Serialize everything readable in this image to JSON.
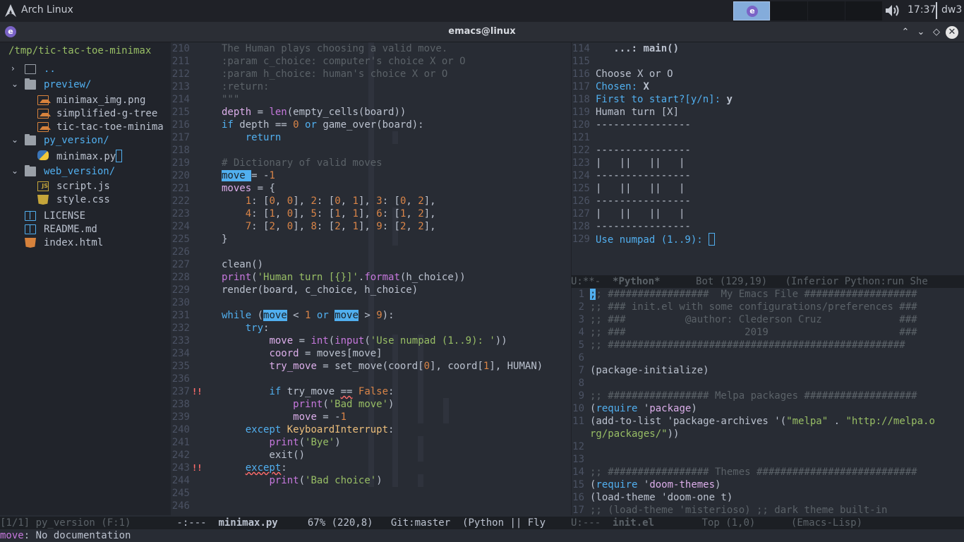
{
  "topbar": {
    "os_title": "Arch Linux",
    "workspace_app": "e",
    "clock": "17:37",
    "wm": "dw3",
    "icons": [
      "arch-linux-icon",
      "emacs-icon",
      "volume-icon"
    ]
  },
  "window": {
    "title": "emacs@linux",
    "app_icon": "e",
    "buttons": [
      "⌃",
      "⌄",
      "◇",
      "✕"
    ]
  },
  "treemacs": {
    "root": "/tmp/tic-tac-toe-minimax",
    "items": [
      {
        "chevron": "›",
        "icon": "book",
        "label": ".."
      },
      {
        "chevron": "⌄",
        "icon": "folder",
        "label": "preview/"
      },
      {
        "chevron": "",
        "icon": "image",
        "label": "minimax_img.png"
      },
      {
        "chevron": "",
        "icon": "image",
        "label": "simplified-g-tree"
      },
      {
        "chevron": "",
        "icon": "image",
        "label": "tic-tac-toe-minima"
      },
      {
        "chevron": "⌄",
        "icon": "folder",
        "label": "py_version/"
      },
      {
        "chevron": "",
        "icon": "python",
        "label": "minimax.py"
      },
      {
        "chevron": "⌄",
        "icon": "folder",
        "label": "web_version/"
      },
      {
        "chevron": "",
        "icon": "js",
        "label": "script.js"
      },
      {
        "chevron": "",
        "icon": "css",
        "label": "style.css"
      },
      {
        "chevron": "",
        "icon": "doc",
        "label": "LICENSE"
      },
      {
        "chevron": "",
        "icon": "doc",
        "label": "README.md"
      },
      {
        "chevron": "",
        "icon": "html",
        "label": "index.html"
      }
    ]
  },
  "editor_python": {
    "lines": [
      {
        "n": "210",
        "html": "<span class='c'>The Human plays choosing a valid move.</span>"
      },
      {
        "n": "211",
        "html": "<span class='c'>:param c_choice: computer's choice X or O</span>"
      },
      {
        "n": "212",
        "html": "<span class='c'>:param h_choice: human's choice X or O</span>"
      },
      {
        "n": "213",
        "html": "<span class='c'>:return:</span>"
      },
      {
        "n": "214",
        "html": "<span class='c'>\"\"\"</span>"
      },
      {
        "n": "215",
        "html": "<span class='v'>depth</span> = <span class='f'>len</span>(empty_cells(board))"
      },
      {
        "n": "216",
        "html": "<span class='k'>if</span> depth == <span class='n'>0</span> <span class='k'>or</span> game_over(board):"
      },
      {
        "n": "217",
        "html": "    <span class='k'>return</span>"
      },
      {
        "n": "218",
        "html": ""
      },
      {
        "n": "219",
        "html": "<span class='c'># Dictionary of valid moves</span>"
      },
      {
        "n": "220",
        "html": "<span class='hl'>move </span>= -<span class='n'>1</span>"
      },
      {
        "n": "221",
        "html": "<span class='v'>moves</span> = {"
      },
      {
        "n": "222",
        "html": "    <span class='n'>1</span>: [<span class='n'>0</span>, <span class='n'>0</span>], <span class='n'>2</span>: [<span class='n'>0</span>, <span class='n'>1</span>], <span class='n'>3</span>: [<span class='n'>0</span>, <span class='n'>2</span>],"
      },
      {
        "n": "223",
        "html": "    <span class='n'>4</span>: [<span class='n'>1</span>, <span class='n'>0</span>], <span class='n'>5</span>: [<span class='n'>1</span>, <span class='n'>1</span>], <span class='n'>6</span>: [<span class='n'>1</span>, <span class='n'>2</span>],"
      },
      {
        "n": "224",
        "html": "    <span class='n'>7</span>: [<span class='n'>2</span>, <span class='n'>0</span>], <span class='n'>8</span>: [<span class='n'>2</span>, <span class='n'>1</span>], <span class='n'>9</span>: [<span class='n'>2</span>, <span class='n'>2</span>],"
      },
      {
        "n": "225",
        "html": "}"
      },
      {
        "n": "226",
        "html": ""
      },
      {
        "n": "227",
        "html": "clean()"
      },
      {
        "n": "228",
        "html": "<span class='f'>print</span>(<span class='s'>'Human turn [{}]'</span>.<span class='f'>format</span>(h_choice))"
      },
      {
        "n": "229",
        "html": "render(board, c_choice, h_choice)"
      },
      {
        "n": "230",
        "html": ""
      },
      {
        "n": "231",
        "html": "<span class='k'>while</span> (<span class='hl'>move</span> &lt; <span class='n'>1</span> <span class='k'>or</span> <span class='hl'>move</span> &gt; <span class='n'>9</span>):"
      },
      {
        "n": "232",
        "html": "    <span class='k'>try</span>:"
      },
      {
        "n": "233",
        "html": "        <span class='v'>move</span> = <span class='f'>int</span>(<span class='f'>input</span>(<span class='s'>'Use numpad (1..9): '</span>))"
      },
      {
        "n": "234",
        "html": "        <span class='v'>coord</span> = moves[move]"
      },
      {
        "n": "235",
        "html": "        <span class='v'>try_move</span> = set_move(coord[<span class='n'>0</span>], coord[<span class='n'>1</span>], HUMAN)"
      },
      {
        "n": "236",
        "html": ""
      },
      {
        "n": "237",
        "warn": "!!",
        "html": "        <span class='k'>if</span> try_move <span class='squig'>==</span> <span class='n'>False</span>:"
      },
      {
        "n": "238",
        "html": "            <span class='f'>print</span>(<span class='s'>'Bad move'</span>)"
      },
      {
        "n": "239",
        "html": "            <span class='v'>move</span> = -<span class='n'>1</span>"
      },
      {
        "n": "240",
        "html": "    <span class='k'>except</span> <span class='e'>KeyboardInterrupt</span>:"
      },
      {
        "n": "241",
        "html": "        <span class='f'>print</span>(<span class='s'>'Bye'</span>)"
      },
      {
        "n": "242",
        "html": "        exit()"
      },
      {
        "n": "243",
        "warn": "!!",
        "html": "    <span class='k squig'>except</span>:"
      },
      {
        "n": "244",
        "html": "        <span class='f'>print</span>(<span class='s'>'Bad choice'</span>)"
      },
      {
        "n": "245",
        "html": ""
      },
      {
        "n": "246",
        "html": ""
      }
    ]
  },
  "repl": {
    "lines": [
      {
        "n": "114",
        "html": "   <span class='b'>...: main()</span>"
      },
      {
        "n": "115",
        "html": ""
      },
      {
        "n": "116",
        "html": "Choose X or O"
      },
      {
        "n": "117",
        "html": "<span class='k'>Chosen: </span><span class='b'>X</span>"
      },
      {
        "n": "118",
        "html": "<span class='k'>First to start?[y/n]: </span><span class='b'>y</span>"
      },
      {
        "n": "119",
        "html": "Human turn [X]"
      },
      {
        "n": "120",
        "html": "----------------"
      },
      {
        "n": "121",
        "html": ""
      },
      {
        "n": "122",
        "html": "----------------"
      },
      {
        "n": "123",
        "html": "|   ||   ||   |"
      },
      {
        "n": "124",
        "html": "----------------"
      },
      {
        "n": "125",
        "html": "|   ||   ||   |"
      },
      {
        "n": "126",
        "html": "----------------"
      },
      {
        "n": "127",
        "html": "|   ||   ||   |"
      },
      {
        "n": "128",
        "html": "----------------"
      },
      {
        "n": "129",
        "html": "<span class='k'>Use numpad (1..9): </span><span class='cursor-box'></span>"
      }
    ]
  },
  "init_el": {
    "lines": [
      {
        "n": "1",
        "html": "<span class='hl'>;</span><span class='c'>; #################  My Emacs File ###################</span>"
      },
      {
        "n": "2",
        "html": "<span class='c'>;; ### init.el with some configurations/preferences ###</span>"
      },
      {
        "n": "3",
        "html": "<span class='c'>;; ###          @author: Clederson Cruz             ###</span>"
      },
      {
        "n": "4",
        "html": "<span class='c'>;; ###                    2019                      ###</span>"
      },
      {
        "n": "5",
        "html": "<span class='c'>;; ##################################################</span>"
      },
      {
        "n": "6",
        "html": ""
      },
      {
        "n": "7",
        "html": "(package-initialize)"
      },
      {
        "n": "8",
        "html": ""
      },
      {
        "n": "9",
        "html": "<span class='c'>;; ################# Melpa packages ###################</span>"
      },
      {
        "n": "10",
        "html": "(<span class='k'>require</span> '<span class='v'>package</span>)"
      },
      {
        "n": "11",
        "html": "(add-to-list 'package-archives '(<span class='s'>\"melpa\"</span> . <span class='s'>\"http://melpa.o</span>"
      },
      {
        "n": "",
        "html": "<span class='s'>rg/packages/\"</span>))"
      },
      {
        "n": "12",
        "html": ""
      },
      {
        "n": "13",
        "html": ""
      },
      {
        "n": "14",
        "html": "<span class='c'>;; ################# Themes ###########################</span>"
      },
      {
        "n": "15",
        "html": "(<span class='k'>require</span> '<span class='v'>doom-themes</span>)"
      },
      {
        "n": "16",
        "html": "(load-theme 'doom-one t)"
      },
      {
        "n": "17",
        "html": "<span class='c'>;; (load-theme 'misterioso) ;; dark theme built-in</span>"
      }
    ]
  },
  "modelines": {
    "tree": "[1/1] py_version (F:1)",
    "python": " -:---  <b>minimax.py</b>     67% (220,8)   Git:master  (Python || Fly",
    "repl": "U:**-  <b>*Python*</b>      Bot (129,19)   (Inferior Python:run She",
    "init": "U:---  <b>init.el</b>        Top (1,0)      (Emacs-Lisp)"
  },
  "echo": {
    "symbol": "move",
    "text": ": No documentation"
  }
}
